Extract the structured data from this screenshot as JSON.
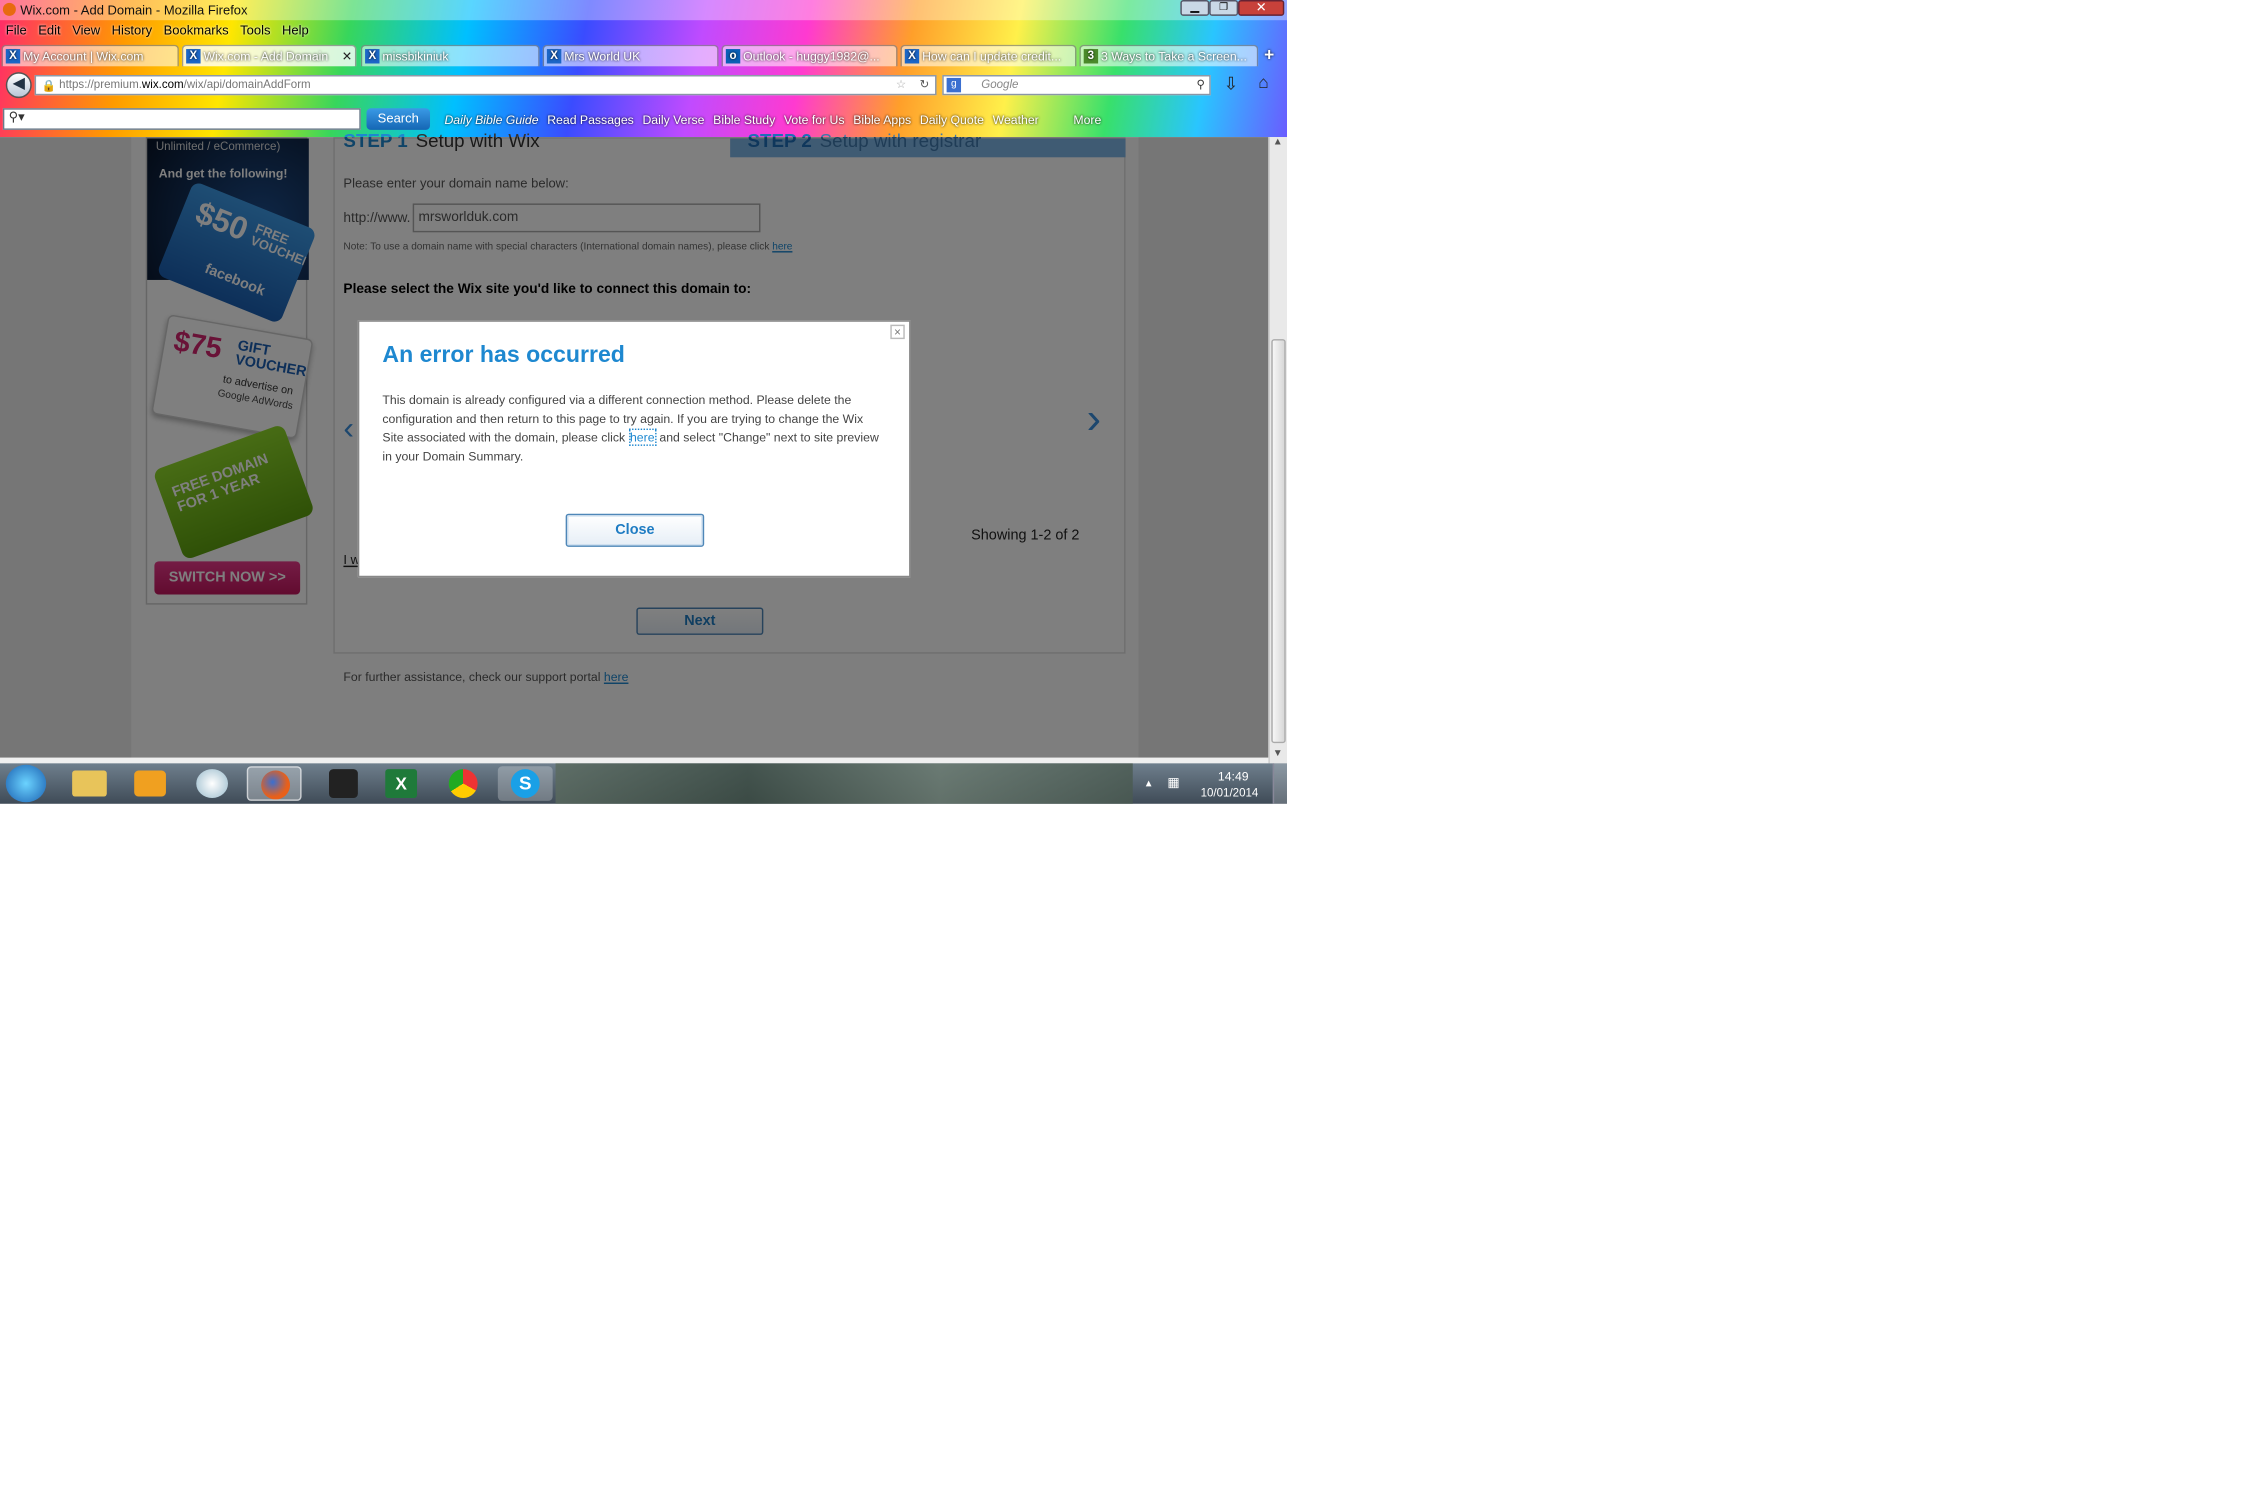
{
  "window": {
    "title": "Wix.com - Add Domain - Mozilla Firefox",
    "controls": [
      "minimize",
      "restore",
      "close"
    ]
  },
  "menu": [
    "File",
    "Edit",
    "View",
    "History",
    "Bookmarks",
    "Tools",
    "Help"
  ],
  "tabs": [
    {
      "label": "My Account | Wix.com",
      "active": false
    },
    {
      "label": "Wix.com - Add Domain",
      "active": true
    },
    {
      "label": "missbikiniuk",
      "active": false
    },
    {
      "label": "Mrs World UK",
      "active": false
    },
    {
      "label": "Outlook - huggy1982@...",
      "active": false
    },
    {
      "label": "How can I update credit...",
      "active": false
    },
    {
      "label": "3 Ways to Take a Screen...",
      "active": false
    }
  ],
  "new_tab_label": "+",
  "address": {
    "prefix": "https://premium.",
    "domain": "wix.com",
    "path": "/wix/api/domainAddForm"
  },
  "search_box": {
    "placeholder": "Google"
  },
  "toolbar": {
    "search_button": "Search",
    "bookmarks": [
      "Daily Bible Guide",
      "Read Passages",
      "Daily Verse",
      "Bible Study",
      "Vote for Us",
      "Bible Apps",
      "Daily Quote",
      "Weather",
      "More"
    ]
  },
  "sidebar_ad": {
    "top_text": "Unlimited / eCommerce)",
    "tagline": "And get the following!",
    "voucher1_amount": "$50",
    "voucher1_text": "FREE VOUCHER",
    "voucher1_brand": "facebook",
    "voucher2_amount": "$75",
    "voucher2_text": "GIFT VOUCHER",
    "voucher2_sub": "to advertise on",
    "voucher2_brand": "Google AdWords",
    "domain_offer": "FREE DOMAIN FOR 1 YEAR",
    "cta": "SWITCH NOW >>"
  },
  "page": {
    "step1": "STEP 1",
    "step1_label": "Setup with Wix",
    "step2": "STEP 2",
    "step2_label": "Setup with registrar",
    "prompt": "Please enter your domain name below:",
    "url_prefix": "http://www.",
    "domain_value": "mrsworlduk.com",
    "note": "Note: To use a domain name with special characters (International domain names), please click",
    "note_link": "here",
    "select_heading": "Please select the Wix site you'd like to connect this domain to:",
    "showing": "Showing 1-2 of 2",
    "partial_link": "I w",
    "next_button": "Next",
    "support_text": "For further assistance, check our support portal",
    "support_link": "here"
  },
  "dialog": {
    "title": "An error has occurred",
    "message_part1": "This domain is already configured via a different connection method. Please delete the configuration and then return to this page to try again. If you are trying to change the Wix Site associated with the domain, please click",
    "message_link": "here",
    "message_part2": "and select \"Change\" next to site preview in your Domain Summary.",
    "close_x": "×",
    "close_button": "Close"
  },
  "taskbar": {
    "time": "14:49",
    "date": "10/01/2014"
  },
  "colors": {
    "accent_blue": "#1e88d0",
    "cta_pink": "#d3246f",
    "green_card": "#7cc21e",
    "overlay": "#000000"
  }
}
